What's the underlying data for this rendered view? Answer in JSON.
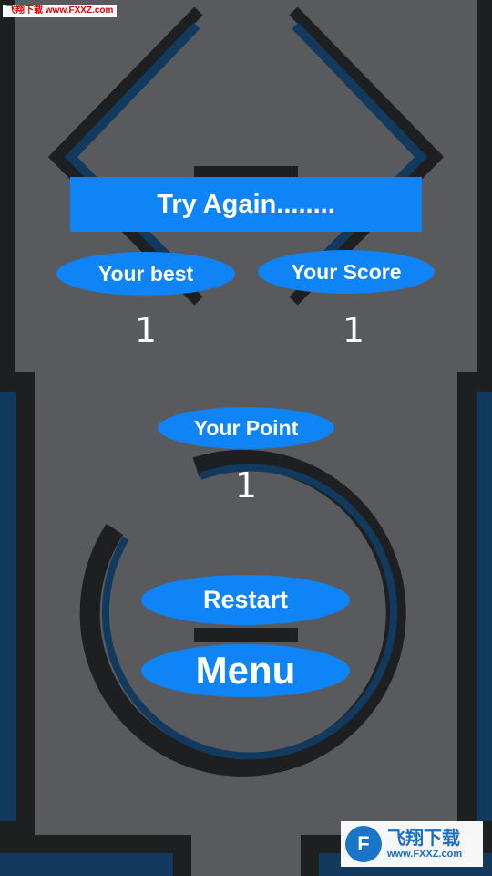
{
  "watermark_top": "飞翔下载 www.FXXZ.com",
  "banner": "Try Again........",
  "best": {
    "label": "Your best",
    "value": "1"
  },
  "score": {
    "label": "Your Score",
    "value": "1"
  },
  "point": {
    "label": "Your Point",
    "value": "1"
  },
  "buttons": {
    "restart": "Restart",
    "menu": "Menu"
  },
  "watermark_bottom": {
    "logo": "F",
    "title": "飞翔下载",
    "url": "www.FXXZ.com"
  },
  "colors": {
    "background": "#585a5d",
    "dark": "#1d1f21",
    "navy": "#123a5f",
    "accent": "#0f84f6"
  }
}
